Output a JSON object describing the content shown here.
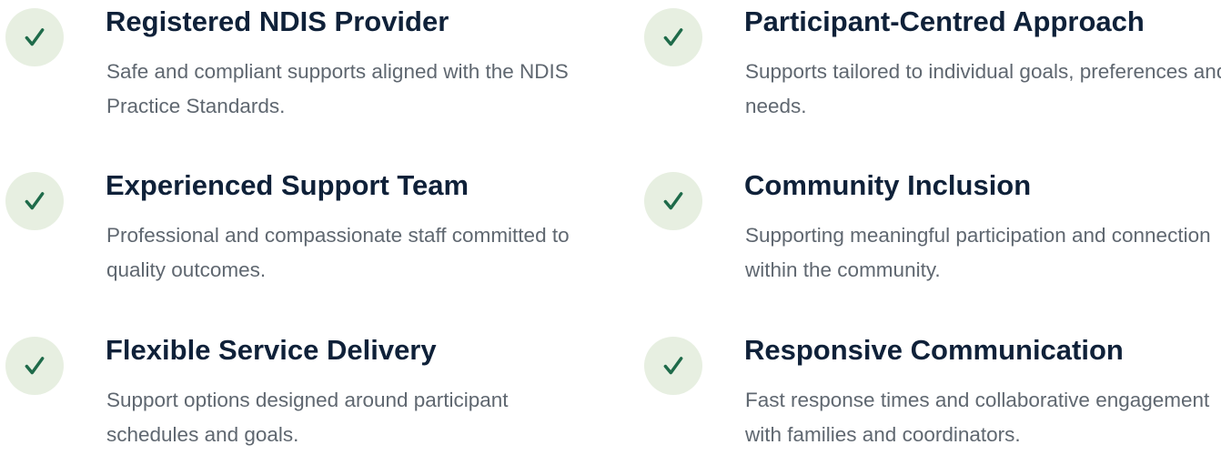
{
  "features": [
    {
      "title": "Registered NDIS Provider",
      "description": "Safe and compliant supports aligned with the NDIS Practice Standards."
    },
    {
      "title": "Participant-Centred Approach",
      "description": "Supports tailored to individual goals, preferences and needs."
    },
    {
      "title": "Experienced Support Team",
      "description": "Professional and compassionate staff committed to quality outcomes."
    },
    {
      "title": "Community Inclusion",
      "description": "Supporting meaningful participation and connection within the community."
    },
    {
      "title": "Flexible Service Delivery",
      "description": "Support options designed around participant schedules and goals."
    },
    {
      "title": "Responsive Communication",
      "description": "Fast response times and collaborative engagement with families and coordinators."
    }
  ],
  "icon": "check-icon",
  "colors": {
    "badge_background": "#e7efe1",
    "check": "#1f6b4a",
    "title": "#0f2139",
    "description": "#5f6770"
  }
}
